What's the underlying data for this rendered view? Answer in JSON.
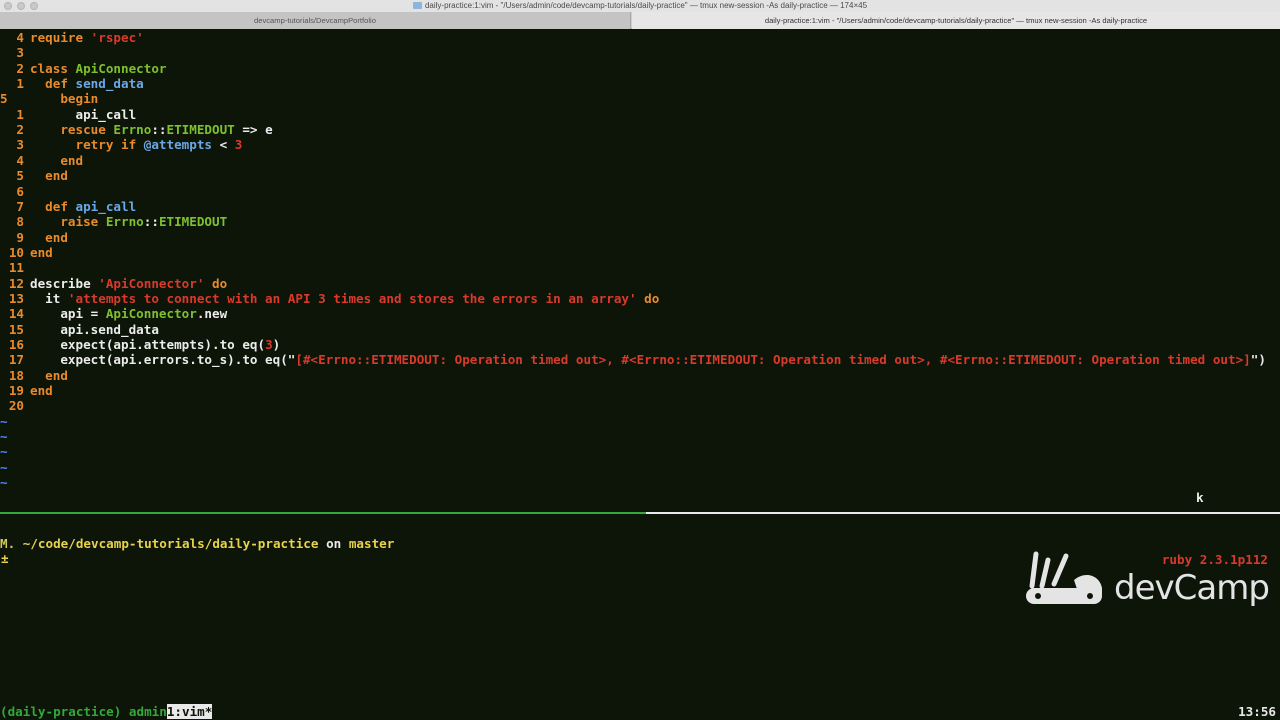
{
  "window": {
    "title": "daily-practice:1:vim - \"/Users/admin/code/devcamp-tutorials/daily-practice\" — tmux new-session -As daily-practice — 174×45"
  },
  "tabs": [
    {
      "label": "devcamp-tutorials/DevcampPortfolio"
    },
    {
      "label": "daily-practice:1:vim - \"/Users/admin/code/devcamp-tutorials/daily-practice\" — tmux new-session -As daily-practice"
    }
  ],
  "editor": {
    "lines": [
      {
        "num": "4",
        "indent": "",
        "tokens": [
          [
            "kw",
            "require "
          ],
          [
            "str",
            "'rspec'"
          ]
        ]
      },
      {
        "num": "3",
        "indent": "",
        "tokens": []
      },
      {
        "num": "2",
        "indent": "",
        "tokens": [
          [
            "kw",
            "class "
          ],
          [
            "cls",
            "ApiConnector"
          ]
        ]
      },
      {
        "num": "1",
        "indent": "  ",
        "tokens": [
          [
            "kw",
            "def "
          ],
          [
            "fn",
            "send_data"
          ]
        ]
      },
      {
        "num": "5",
        "indent": "    ",
        "tokens": [
          [
            "kw",
            "begin"
          ]
        ],
        "current": true
      },
      {
        "num": "1",
        "indent": "      ",
        "tokens": [
          [
            "txt",
            "api_call"
          ]
        ]
      },
      {
        "num": "2",
        "indent": "    ",
        "tokens": [
          [
            "kw",
            "rescue "
          ],
          [
            "cls",
            "Errno"
          ],
          [
            "txt",
            "::"
          ],
          [
            "cls",
            "ETIMEDOUT"
          ],
          [
            "txt",
            " => e"
          ]
        ]
      },
      {
        "num": "3",
        "indent": "      ",
        "tokens": [
          [
            "kw",
            "retry if "
          ],
          [
            "iv",
            "@attempts"
          ],
          [
            "txt",
            " < "
          ],
          [
            "str",
            "3"
          ]
        ]
      },
      {
        "num": "4",
        "indent": "    ",
        "tokens": [
          [
            "kw",
            "end"
          ]
        ]
      },
      {
        "num": "5",
        "indent": "  ",
        "tokens": [
          [
            "kw",
            "end"
          ]
        ]
      },
      {
        "num": "6",
        "indent": "",
        "tokens": []
      },
      {
        "num": "7",
        "indent": "  ",
        "tokens": [
          [
            "kw",
            "def "
          ],
          [
            "fn",
            "api_call"
          ]
        ]
      },
      {
        "num": "8",
        "indent": "    ",
        "tokens": [
          [
            "kw",
            "raise "
          ],
          [
            "cls",
            "Errno"
          ],
          [
            "txt",
            "::"
          ],
          [
            "cls",
            "ETIMEDOUT"
          ]
        ]
      },
      {
        "num": "9",
        "indent": "  ",
        "tokens": [
          [
            "kw",
            "end"
          ]
        ]
      },
      {
        "num": "10",
        "indent": "",
        "tokens": [
          [
            "kw",
            "end"
          ]
        ]
      },
      {
        "num": "11",
        "indent": "",
        "tokens": []
      },
      {
        "num": "12",
        "indent": "",
        "tokens": [
          [
            "txt",
            "describe "
          ],
          [
            "str",
            "'ApiConnector'"
          ],
          [
            "kw",
            " do"
          ]
        ]
      },
      {
        "num": "13",
        "indent": "  ",
        "tokens": [
          [
            "txt",
            "it "
          ],
          [
            "str",
            "'attempts to connect with an API 3 times and stores the errors in an array'"
          ],
          [
            "kw",
            " do"
          ]
        ]
      },
      {
        "num": "14",
        "indent": "    ",
        "tokens": [
          [
            "txt",
            "api = "
          ],
          [
            "cls",
            "ApiConnector"
          ],
          [
            "txt",
            ".new"
          ]
        ]
      },
      {
        "num": "15",
        "indent": "    ",
        "tokens": [
          [
            "txt",
            "api.send_data"
          ]
        ]
      },
      {
        "num": "16",
        "indent": "    ",
        "tokens": [
          [
            "txt",
            "expect(api.attempts).to eq("
          ],
          [
            "str",
            "3"
          ],
          [
            "txt",
            ")"
          ]
        ]
      },
      {
        "num": "17",
        "indent": "    ",
        "tokens": [
          [
            "txt",
            "expect(api.errors.to_s).to eq(\""
          ],
          [
            "str",
            "[#<Errno::ETIMEDOUT: Operation timed out>, #<Errno::ETIMEDOUT: Operation timed out>, #<Errno::ETIMEDOUT: Operation timed out>]"
          ],
          [
            "txt",
            "\")"
          ]
        ]
      },
      {
        "num": "18",
        "indent": "  ",
        "tokens": [
          [
            "kw",
            "end"
          ]
        ]
      },
      {
        "num": "19",
        "indent": "",
        "tokens": [
          [
            "kw",
            "end"
          ]
        ]
      },
      {
        "num": "20",
        "indent": "",
        "tokens": []
      }
    ],
    "tildes": [
      "~",
      "~",
      "~",
      "~",
      "~"
    ],
    "pending_key": "k"
  },
  "shell": {
    "git_status": "M.",
    "path": "~/code/devcamp-tutorials/daily-practice",
    "on": "on",
    "branch": "master",
    "second_line": "±",
    "ruby_version": "ruby 2.3.1p112"
  },
  "logo": {
    "text": "devCamp"
  },
  "tmux": {
    "session": "(daily-practice)",
    "user": "admin",
    "window": "1:vim*",
    "time": "13:56"
  },
  "colors": {
    "background": "#0d1408",
    "keyword": "#e88b2e",
    "constant": "#7ec02e",
    "method": "#6aa8e6",
    "string": "#d93a2b",
    "tmux_active": "#34a83a"
  }
}
